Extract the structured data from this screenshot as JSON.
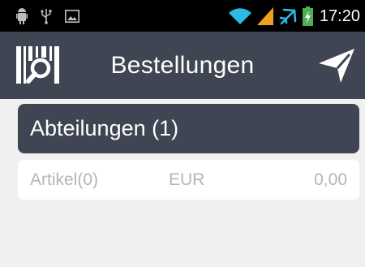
{
  "status_bar": {
    "time": "17:20",
    "left_icons": [
      "android-debug-icon",
      "usb-icon",
      "image-notification-icon"
    ],
    "right_icons": [
      "wifi-icon",
      "cell-signal-icon",
      "airplane-mode-icon",
      "battery-charging-icon"
    ]
  },
  "app_bar": {
    "title": "Bestellungen",
    "left_action_icon": "barcode-scan-icon",
    "right_action_icon": "send-icon"
  },
  "section": {
    "header_label": "Abteilungen (1)"
  },
  "summary_row": {
    "articles": "Artikel(0)",
    "currency": "EUR",
    "amount": "0,00"
  },
  "colors": {
    "app_bar_bg": "#3f4552",
    "page_bg": "#f0f0f0",
    "status_bar_bg": "#000000",
    "row_text": "#b4b4b4",
    "wifi_accent": "#2db8e6",
    "signal_accent": "#f0a020",
    "battery_accent": "#4caf50"
  }
}
